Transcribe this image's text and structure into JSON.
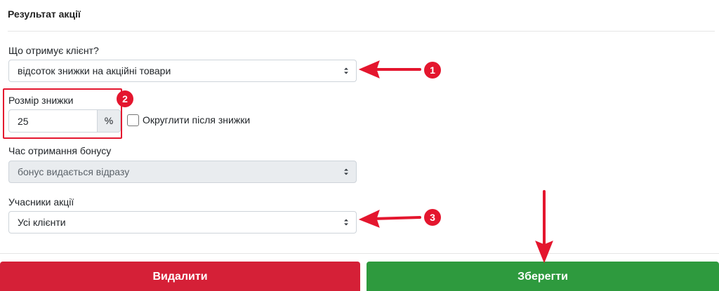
{
  "section": {
    "title": "Результат акції"
  },
  "fields": {
    "reward_type": {
      "label": "Що отримує клієнт?",
      "value": "відсоток знижки на акційні товари"
    },
    "discount": {
      "label": "Розмір знижки",
      "value": "25",
      "unit": "%"
    },
    "round_after_discount": {
      "label": "Округлити після знижки",
      "checked": false
    },
    "bonus_time": {
      "label": "Час отримання бонусу",
      "value": "бонус видається відразу",
      "disabled": true
    },
    "participants": {
      "label": "Учасники акції",
      "value": "Усі клієнти"
    }
  },
  "actions": {
    "delete_label": "Видалити",
    "save_label": "Зберегти"
  },
  "annotations": {
    "badges": [
      "1",
      "2",
      "3"
    ],
    "color": "#e4162e"
  },
  "colors": {
    "delete": "#d52037",
    "save": "#2e9a3e",
    "disabled_bg": "#e9ecef"
  }
}
